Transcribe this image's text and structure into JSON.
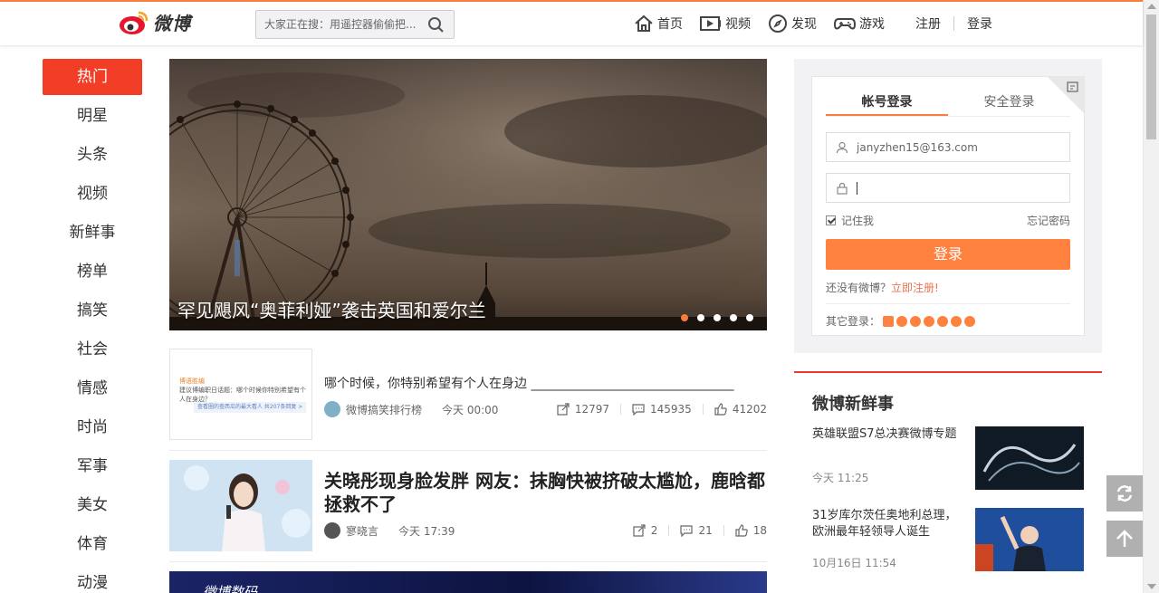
{
  "header": {
    "logo_text": "微博",
    "search": {
      "placeholder": "大家正在搜：用遥控器偷偷把..."
    },
    "nav": [
      {
        "label": "首页",
        "icon": "home-icon"
      },
      {
        "label": "视频",
        "icon": "video-icon"
      },
      {
        "label": "发现",
        "icon": "compass-icon"
      },
      {
        "label": "游戏",
        "icon": "gamepad-icon"
      }
    ],
    "register": "注册",
    "login": "登录"
  },
  "left_nav": [
    "热门",
    "明星",
    "头条",
    "视频",
    "新鲜事",
    "榜单",
    "搞笑",
    "社会",
    "情感",
    "时尚",
    "军事",
    "美女",
    "体育",
    "动漫"
  ],
  "banner": {
    "caption": "罕见飓风“奥菲利娅”袭击英国和爱尔兰",
    "dots": 5,
    "active_dot": 0
  },
  "feed": [
    {
      "title": "哪个时候，你特别希望有个人在身边 ________________________________",
      "author": "微博搞笑排行榜",
      "time": "今天 00:00",
      "reposts": "12797",
      "comments": "145935",
      "likes": "41202",
      "thumb_tag": "博语胜编",
      "thumb_text": "建议博编职日话题：哪个时候你特别希望有个人在身边？",
      "thumb_link": "查看圈的查西瓜的最大看人 共207条回复 >"
    },
    {
      "title": "关晓彤现身脸发胖 网友：抹胸快被挤破太尴尬，鹿晗都拯救不了",
      "author": "寥晓言",
      "time": "今天 17:39",
      "reposts": "2",
      "comments": "21",
      "likes": "18"
    }
  ],
  "bottom_banner_text": "微博数码",
  "login_box": {
    "tabs": [
      "帐号登录",
      "安全登录"
    ],
    "username": "janyzhen15@163.com",
    "remember": "记住我",
    "forgot": "忘记密码",
    "login_button": "登录",
    "no_account": "还没有微博？",
    "register_now": "立即注册!",
    "other_login": "其它登录："
  },
  "fresh": {
    "title": "微博新鲜事",
    "items": [
      {
        "title": "英雄联盟S7总决赛微博专题",
        "time": "今天 11:25"
      },
      {
        "title": "31岁库尔茨任奥地利总理，欧洲最年轻领导人诞生",
        "time": "10月16日 11:54"
      }
    ]
  },
  "colors": {
    "accent": "#fa7d3c",
    "hot": "#f33e27",
    "login_btn": "#ff8140"
  }
}
